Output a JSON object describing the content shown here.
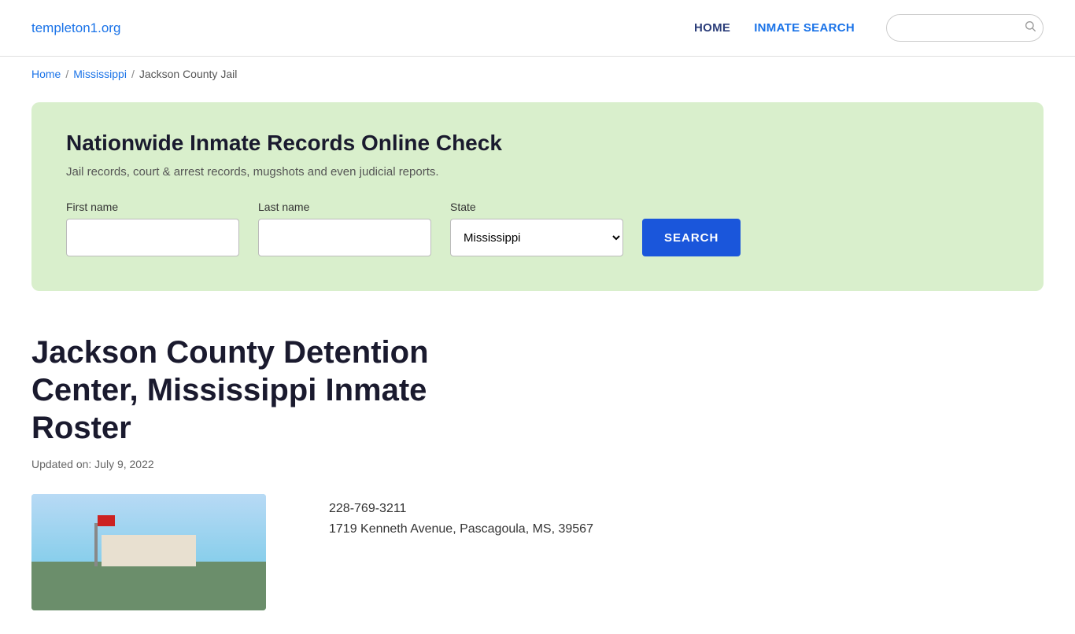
{
  "nav": {
    "brand": "templeton1.org",
    "links": [
      {
        "label": "HOME",
        "id": "home"
      },
      {
        "label": "INMATE SEARCH",
        "id": "inmate-search"
      }
    ],
    "search_placeholder": ""
  },
  "breadcrumb": {
    "items": [
      {
        "label": "Home",
        "link": true
      },
      {
        "label": "Mississippi",
        "link": true
      },
      {
        "label": "Jackson County Jail",
        "link": false
      }
    ]
  },
  "search_panel": {
    "title": "Nationwide Inmate Records Online Check",
    "description": "Jail records, court & arrest records, mugshots and even judicial reports.",
    "first_name_label": "First name",
    "last_name_label": "Last name",
    "state_label": "State",
    "state_default": "Mississippi",
    "search_button_label": "SEARCH"
  },
  "main": {
    "page_title": "Jackson County Detention Center, Mississippi Inmate Roster",
    "updated_label": "Updated on: July 9, 2022",
    "facility": {
      "phone": "228-769-3211",
      "address": "1719 Kenneth Avenue, Pascagoula, MS, 39567"
    }
  }
}
